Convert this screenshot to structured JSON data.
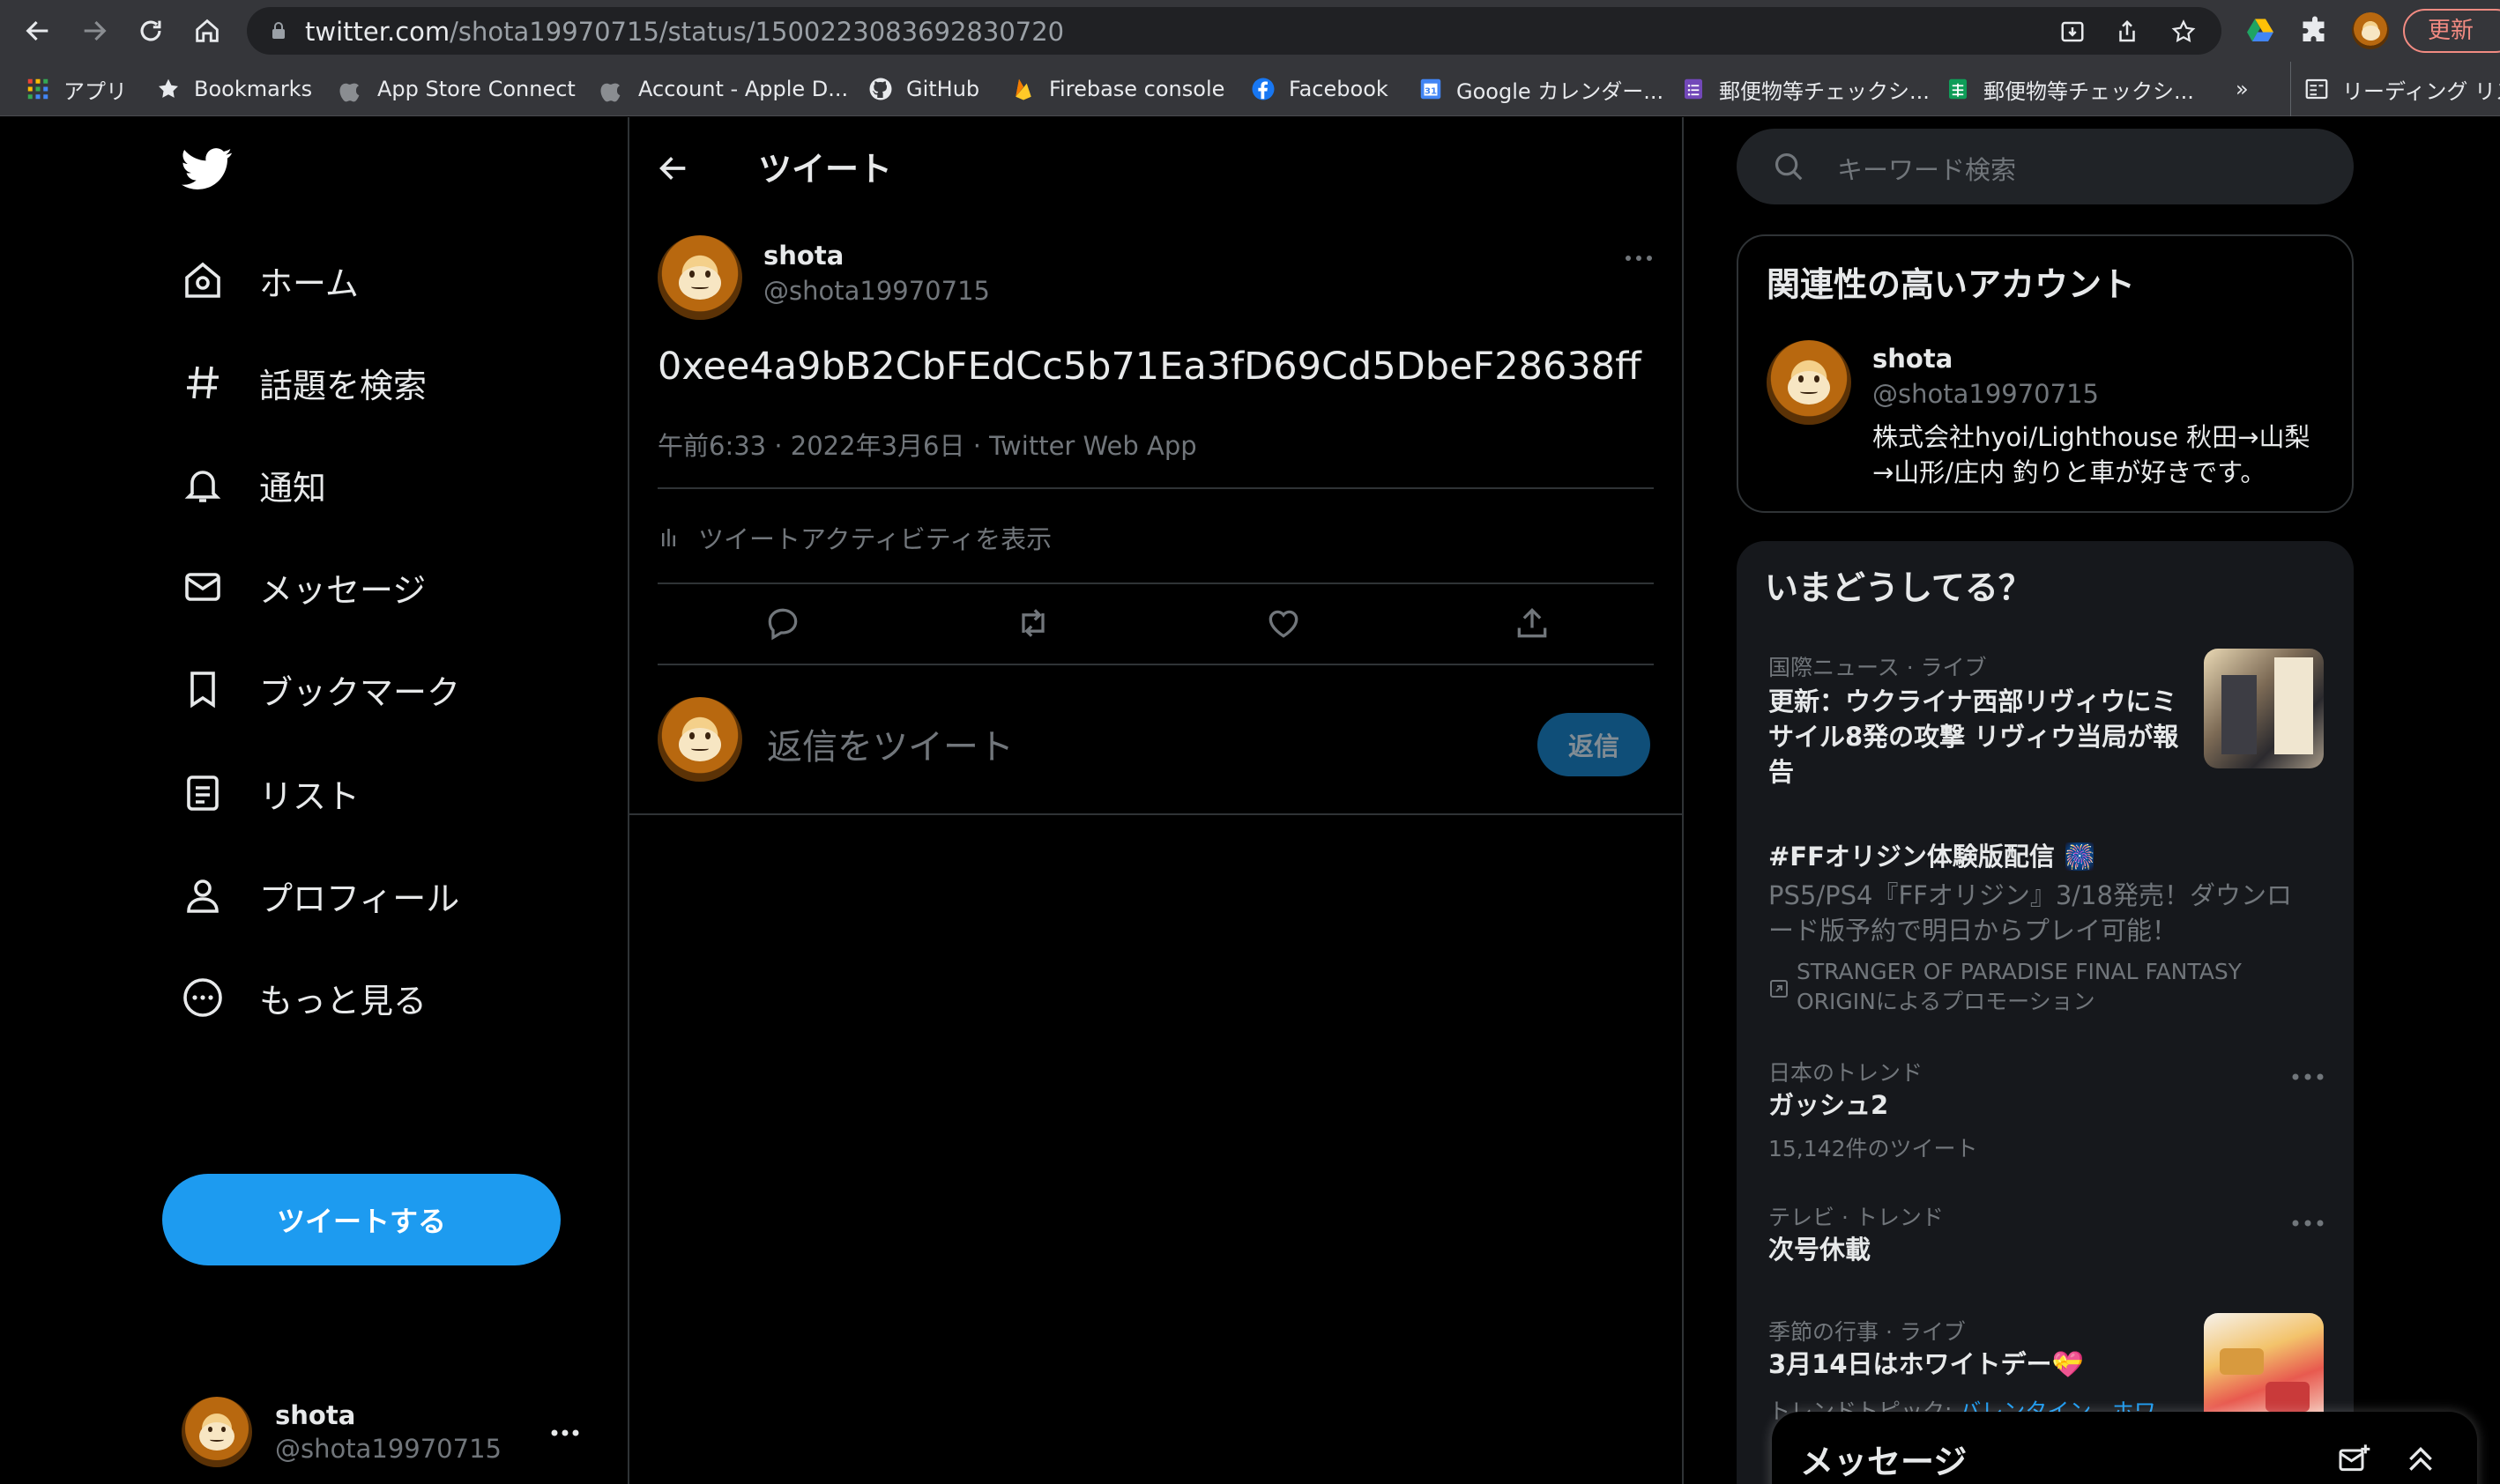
{
  "browser": {
    "url_host": "twitter.com",
    "url_path": "/shota19970715/status/1500223083692830720",
    "update_label": "更新",
    "bookmarks": [
      {
        "label": "アプリ",
        "icon": "apps-grid-icon"
      },
      {
        "label": "Bookmarks",
        "icon": "star-icon"
      },
      {
        "label": "App Store Connect",
        "icon": "apple-icon"
      },
      {
        "label": "Account - Apple D...",
        "icon": "apple-icon"
      },
      {
        "label": "GitHub",
        "icon": "github-icon"
      },
      {
        "label": "Firebase console",
        "icon": "firebase-icon"
      },
      {
        "label": "Facebook",
        "icon": "facebook-icon"
      },
      {
        "label": "Google カレンダー...",
        "icon": "calendar-icon"
      },
      {
        "label": "郵便物等チェックシ...",
        "icon": "form-icon"
      },
      {
        "label": "郵便物等チェックシ...",
        "icon": "sheet-icon"
      }
    ],
    "overflow_label": "»",
    "reading_list_label": "リーディング リスト"
  },
  "sidebar": {
    "items": [
      {
        "label": "ホーム",
        "icon": "home-icon"
      },
      {
        "label": "話題を検索",
        "icon": "hashtag-icon"
      },
      {
        "label": "通知",
        "icon": "bell-icon"
      },
      {
        "label": "メッセージ",
        "icon": "envelope-icon"
      },
      {
        "label": "ブックマーク",
        "icon": "bookmark-icon"
      },
      {
        "label": "リスト",
        "icon": "list-icon"
      },
      {
        "label": "プロフィール",
        "icon": "person-icon"
      },
      {
        "label": "もっと見る",
        "icon": "more-circle-icon"
      }
    ],
    "tweet_button": "ツイートする",
    "account": {
      "name": "shota",
      "handle": "@shota19970715"
    }
  },
  "main": {
    "header_title": "ツイート",
    "tweet": {
      "name": "shota",
      "handle": "@shota19970715",
      "text": "0xee4a9bB2CbFEdCc5b71Ea3fD69Cd5DbeF28638ff",
      "meta": "午前6:33 · 2022年3月6日 · Twitter Web App",
      "activity": "ツイートアクティビティを表示"
    },
    "reply_placeholder": "返信をツイート",
    "reply_button": "返信"
  },
  "right": {
    "search_placeholder": "キーワード検索",
    "related": {
      "title": "関連性の高いアカウント",
      "name": "shota",
      "handle": "@shota19970715",
      "bio": "株式会社hyoi/Lighthouse 秋田→山梨→山形/庄内 釣りと車が好きです。"
    },
    "trends": {
      "title": "いまどうしてる？",
      "items": [
        {
          "category": "国際ニュース · ライブ",
          "title": "更新：ウクライナ西部リヴィウにミサイル8発の攻撃 リヴィウ当局が報告"
        },
        {
          "title": "#FFオリジン体験版配信 🎆",
          "desc": "PS5/PS4『FFオリジン』3/18発売！ダウンロード版予約で明日からプレイ可能！",
          "promo": "STRANGER OF PARADISE FINAL FANTASY ORIGINによるプロモーション"
        },
        {
          "category": "日本のトレンド",
          "title": "ガッシュ2",
          "count": "15,142件のツイート"
        },
        {
          "category": "テレビ · トレンド",
          "title": "次号休載"
        },
        {
          "category": "季節の行事 · ライブ",
          "title": "3月14日はホワイトデー💝",
          "topic_prefix": "トレンドトピック:",
          "topic_links": "バレンタイン、ホワ"
        }
      ]
    },
    "messages_drawer": "メッセージ"
  },
  "colors": {
    "accent": "#1d9bf0",
    "background": "#000000",
    "card": "#16181c",
    "border": "#2f3336",
    "muted": "#71767b"
  }
}
